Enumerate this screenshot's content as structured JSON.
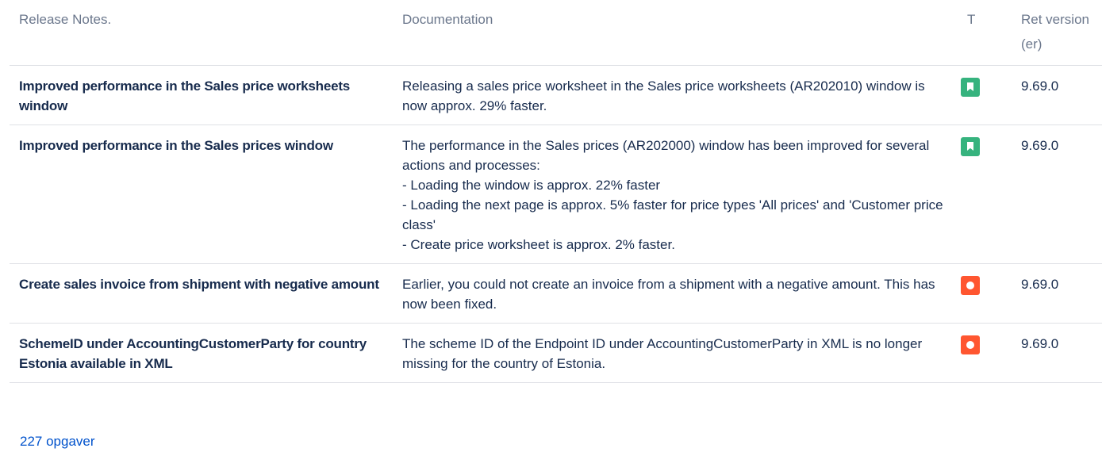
{
  "table": {
    "headers": {
      "release_notes": "Release Notes.",
      "documentation": "Documentation",
      "type": "T",
      "version": "Ret version (er)"
    },
    "rows": [
      {
        "summary": "Improved performance in the Sales price worksheets window",
        "doc_lines": [
          "Releasing a sales price worksheet in the Sales price worksheets (AR202010) window is now approx. 29% faster."
        ],
        "type": "improvement-icon",
        "version": "9.69.0"
      },
      {
        "summary": "Improved performance in the Sales prices window",
        "doc_lines": [
          "The performance in the Sales prices (AR202000) window has been improved for several actions and processes:",
          "- Loading the window is approx. 22% faster",
          "- Loading the next page is approx. 5% faster for price types 'All prices' and 'Customer price class'",
          "- Create price worksheet is approx. 2% faster."
        ],
        "type": "improvement-icon",
        "version": "9.69.0"
      },
      {
        "summary": "Create sales invoice from shipment with negative amount",
        "doc_lines": [
          "Earlier, you could not create an invoice from a shipment with a negative amount. This has now been fixed."
        ],
        "type": "bug-icon",
        "version": "9.69.0"
      },
      {
        "summary": "SchemeID under AccountingCustomerParty for country Estonia available in XML",
        "doc_lines": [
          "The scheme ID of the Endpoint ID under AccountingCustomerParty in XML is no longer missing for the country of Estonia."
        ],
        "type": "bug-icon",
        "version": "9.69.0"
      }
    ]
  },
  "footer": {
    "count_link": "227 opgaver"
  },
  "colors": {
    "improvement": "#36b37e",
    "bug": "#ff5630",
    "link": "#0052cc",
    "header_text": "#6b778c"
  }
}
